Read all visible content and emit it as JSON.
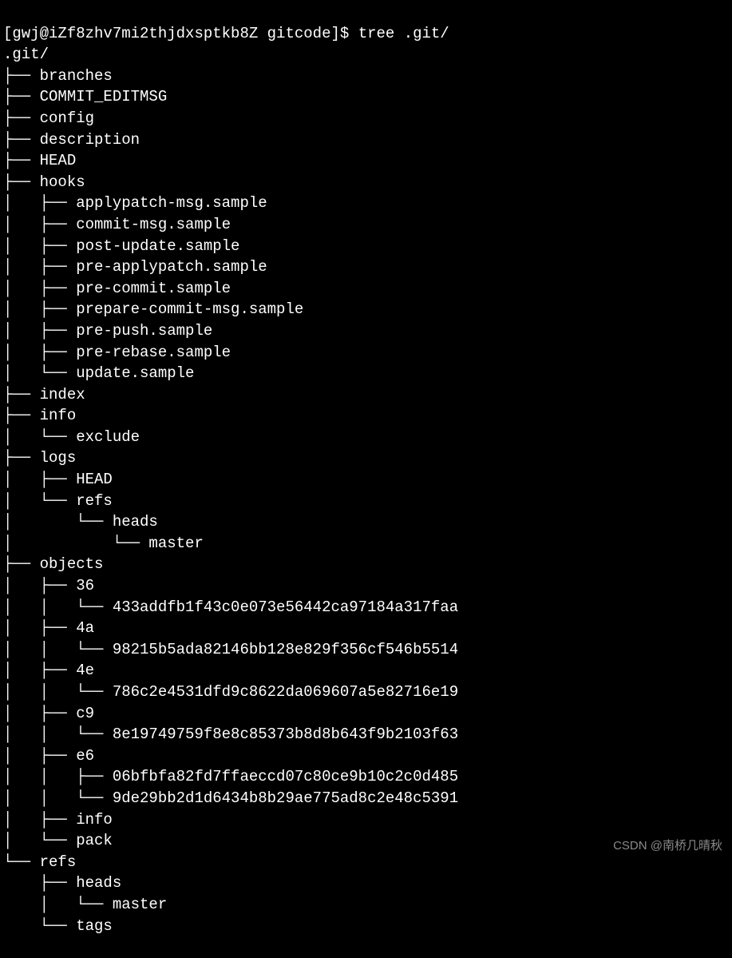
{
  "prompt": {
    "user_host": "[gwj@iZf8zhv7mi2thjdxsptkb8Z gitcode]$",
    "command": "tree .git/"
  },
  "tree_root": ".git/",
  "tree_lines": [
    "├── branches",
    "├── COMMIT_EDITMSG",
    "├── config",
    "├── description",
    "├── HEAD",
    "├── hooks",
    "│   ├── applypatch-msg.sample",
    "│   ├── commit-msg.sample",
    "│   ├── post-update.sample",
    "│   ├── pre-applypatch.sample",
    "│   ├── pre-commit.sample",
    "│   ├── prepare-commit-msg.sample",
    "│   ├── pre-push.sample",
    "│   ├── pre-rebase.sample",
    "│   └── update.sample",
    "├── index",
    "├── info",
    "│   └── exclude",
    "├── logs",
    "│   ├── HEAD",
    "│   └── refs",
    "│       └── heads",
    "│           └── master",
    "├── objects",
    "│   ├── 36",
    "│   │   └── 433addfb1f43c0e073e56442ca97184a317faa",
    "│   ├── 4a",
    "│   │   └── 98215b5ada82146bb128e829f356cf546b5514",
    "│   ├── 4e",
    "│   │   └── 786c2e4531dfd9c8622da069607a5e82716e19",
    "│   ├── c9",
    "│   │   └── 8e19749759f8e8c85373b8d8b643f9b2103f63",
    "│   ├── e6",
    "│   │   ├── 06bfbfa82fd7ffaeccd07c80ce9b10c2c0d485",
    "│   │   └── 9de29bb2d1d6434b8b29ae775ad8c2e48c5391",
    "│   ├── info",
    "│   └── pack",
    "└── refs",
    "    ├── heads",
    "    │   └── master",
    "    └── tags"
  ],
  "watermark": "CSDN @南桥几晴秋"
}
